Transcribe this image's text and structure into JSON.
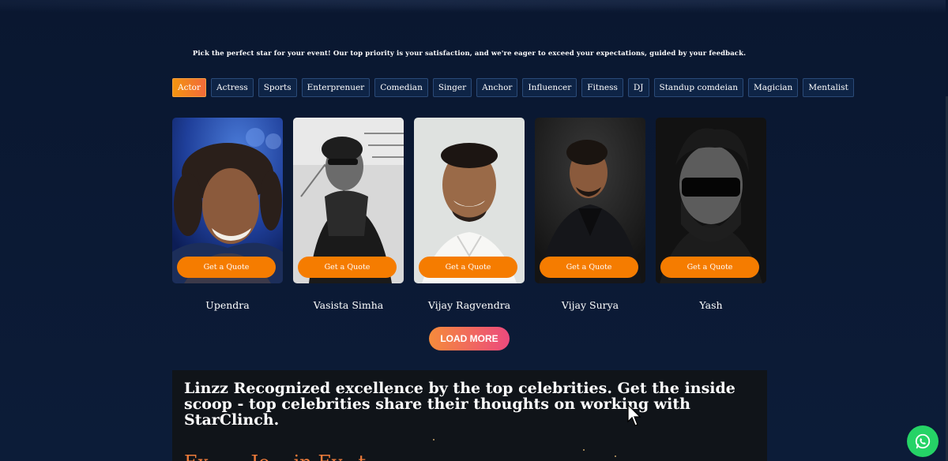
{
  "intro_text": "Pick the perfect star for your event! Our top priority is your satisfaction, and we're eager to exceed your expectations, guided by your feedback.",
  "tabs": [
    {
      "label": "Actor",
      "active": true
    },
    {
      "label": "Actress",
      "active": false
    },
    {
      "label": "Sports",
      "active": false
    },
    {
      "label": "Enterprenuer",
      "active": false
    },
    {
      "label": "Comedian",
      "active": false
    },
    {
      "label": "Singer",
      "active": false
    },
    {
      "label": "Anchor",
      "active": false
    },
    {
      "label": "Influencer",
      "active": false
    },
    {
      "label": "Fitness",
      "active": false
    },
    {
      "label": "DJ",
      "active": false
    },
    {
      "label": "Standup comdeian",
      "active": false
    },
    {
      "label": "Magician",
      "active": false
    },
    {
      "label": "Mentalist",
      "active": false
    }
  ],
  "cards": [
    {
      "name": "Upendra",
      "button_label": "Get a Quote"
    },
    {
      "name": "Vasista Simha",
      "button_label": "Get a Quote"
    },
    {
      "name": "Vijay Ragvendra",
      "button_label": "Get a Quote"
    },
    {
      "name": "Vijay Surya",
      "button_label": "Get a Quote"
    },
    {
      "name": "Yash",
      "button_label": "Get a Quote"
    }
  ],
  "load_more_label": "LOAD MORE",
  "testimonial": {
    "heading": "Linzz Recognized excellence by the top celebrities. Get the inside scoop - top celebrities share their thoughts on working with StarClinch.",
    "subheading": "Ex... ...Jo... in Ev...t"
  },
  "colors": {
    "background": "#0b1a33",
    "accent_orange": "#f57c00",
    "tab_border": "#2a4a78",
    "whatsapp_green": "#25d366"
  },
  "icons": {
    "whatsapp": "whatsapp-icon",
    "cursor": "mouse-pointer-icon"
  }
}
